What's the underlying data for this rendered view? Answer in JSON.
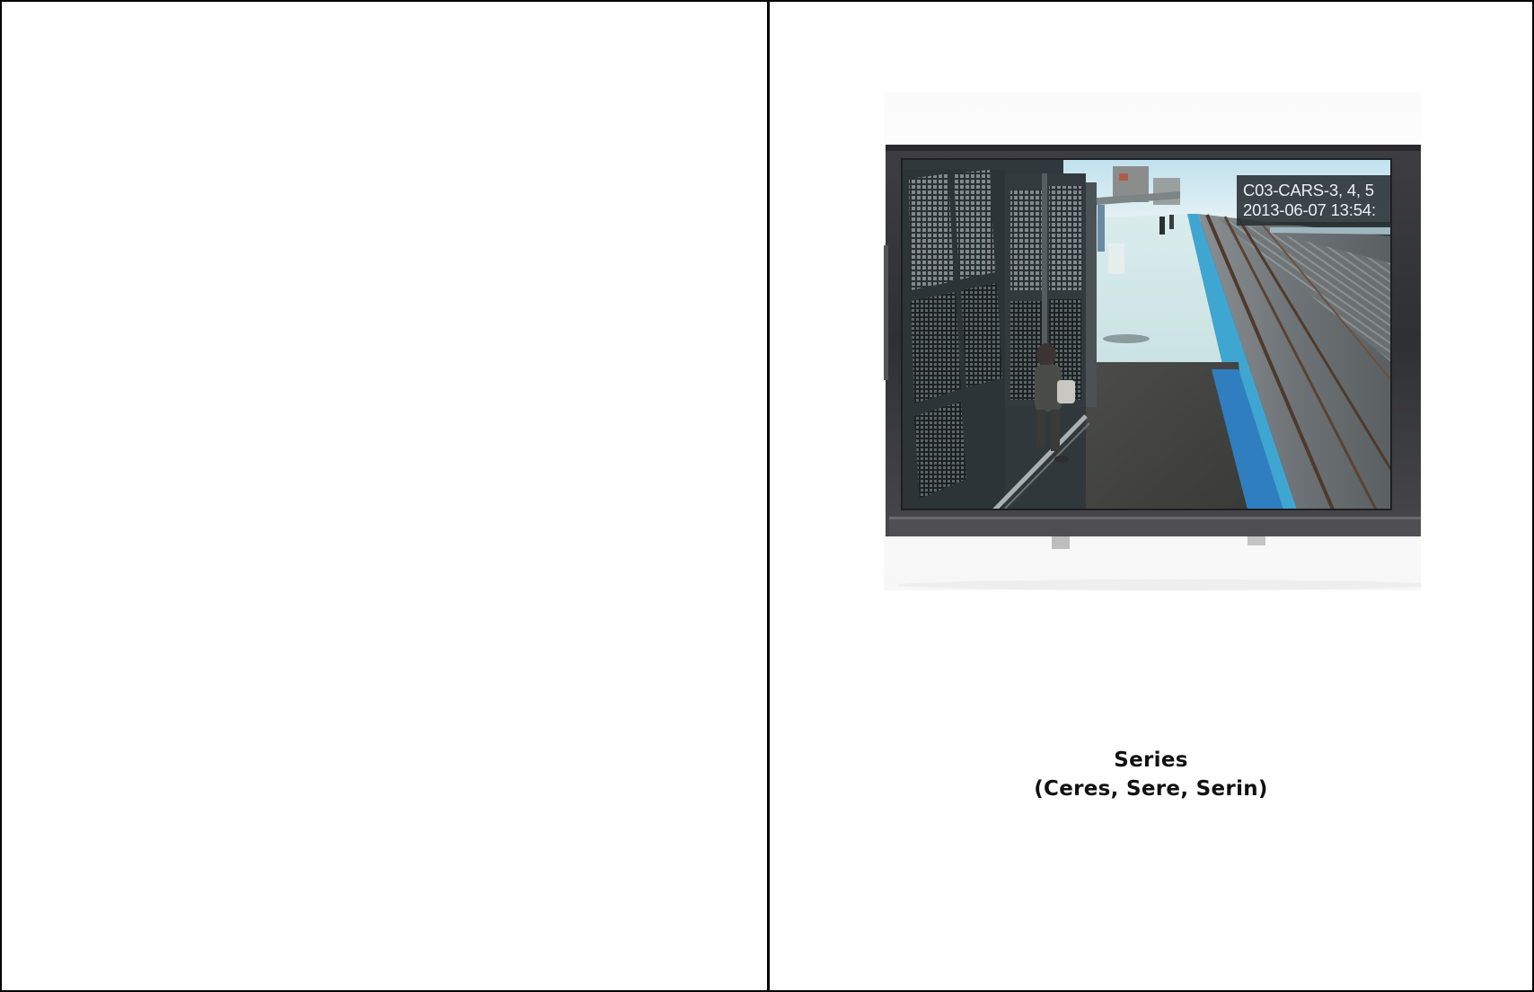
{
  "photo": {
    "subject": "cctv-monitor",
    "overlay": {
      "line1": "C03-CARS-3, 4, 5",
      "line2": "2013-06-07 13:54:"
    }
  },
  "caption": {
    "title": "Series",
    "subtitle": "(Ceres, Sere, Serin)"
  }
}
